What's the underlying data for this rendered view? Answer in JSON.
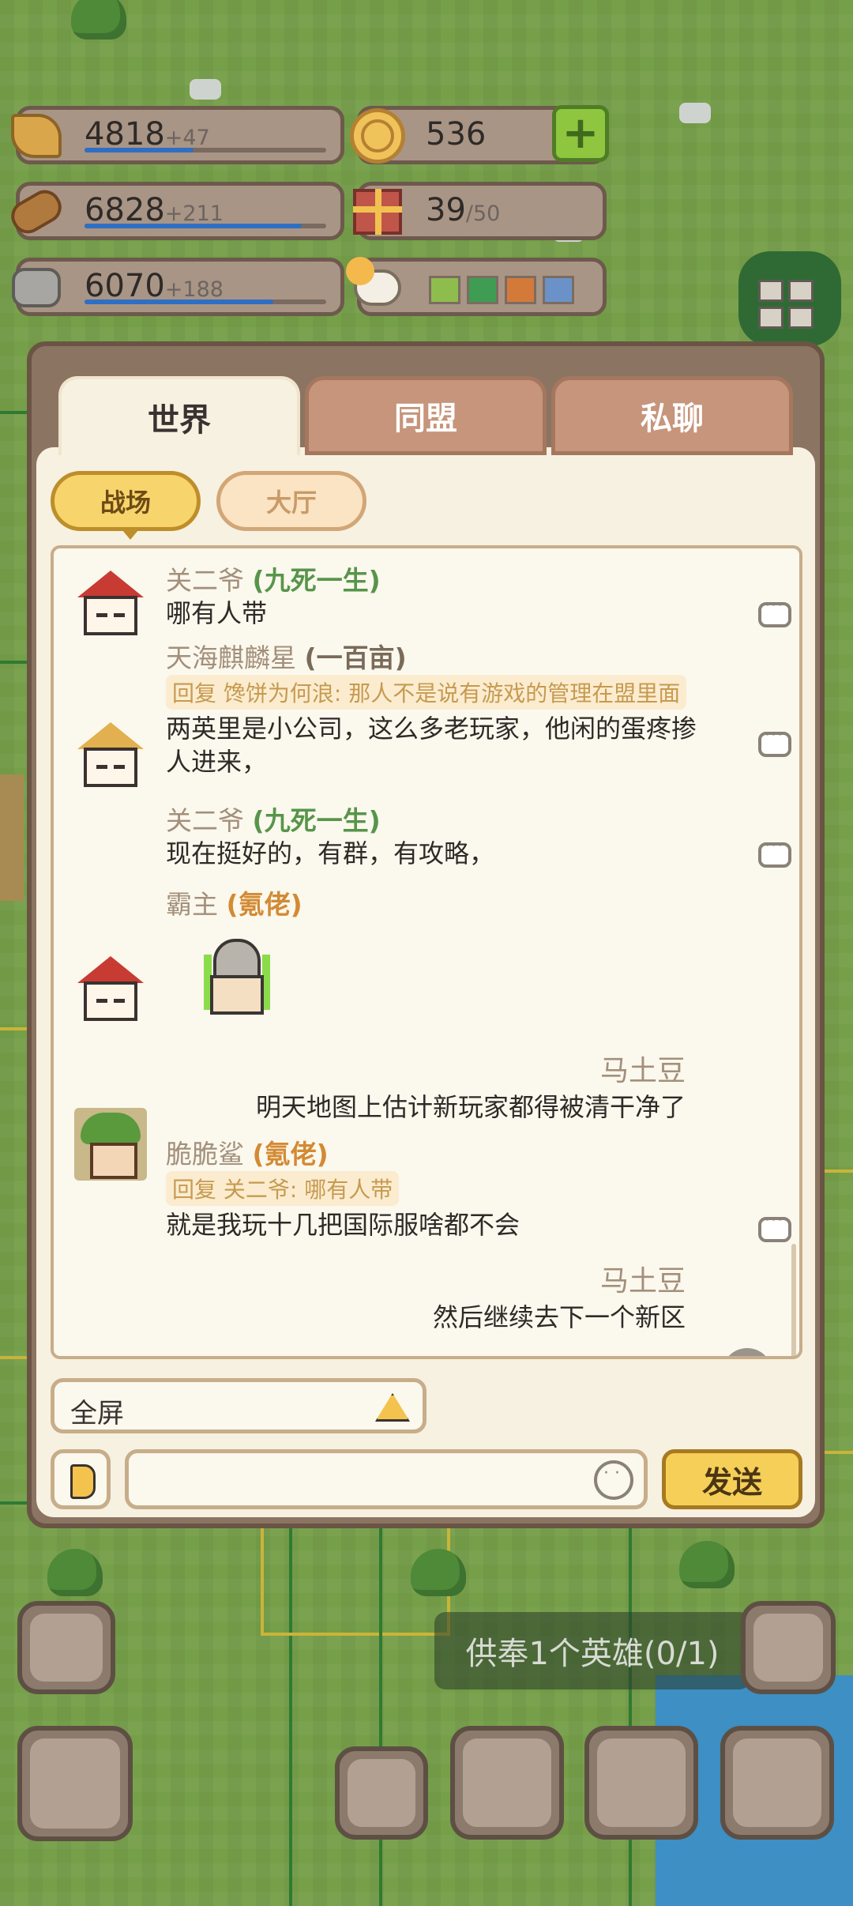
{
  "resources": {
    "food": {
      "value": "4818",
      "increment": "+47",
      "icon": "wheat-icon",
      "fill": 0.45
    },
    "wood": {
      "value": "6828",
      "increment": "+211",
      "icon": "wood-log-icon",
      "fill": 0.9
    },
    "stone": {
      "value": "6070",
      "increment": "+188",
      "icon": "stone-icon",
      "fill": 0.78
    },
    "gold": {
      "value": "536",
      "icon": "coin-icon"
    },
    "gift": {
      "value": "39",
      "max": "/50",
      "icon": "gift-box-icon"
    },
    "weather_colors": [
      "#8fbd4d",
      "#3f9c53",
      "#d37a3b",
      "#6a92c8"
    ]
  },
  "tabs": [
    {
      "label": "世界",
      "active": true
    },
    {
      "label": "同盟",
      "active": false
    },
    {
      "label": "私聊",
      "active": false
    }
  ],
  "subtabs": [
    {
      "label": "战场",
      "active": true
    },
    {
      "label": "大厅",
      "active": false
    }
  ],
  "messages": [
    {
      "name": "关二爷",
      "title": "(九死一生)",
      "text": "哪有人带"
    },
    {
      "name": "天海麒麟星",
      "title": "(一百亩)",
      "reply": "回复 馋饼为何浪: 那人不是说有游戏的管理在盟里面",
      "text": "两英里是小公司，这么多老玩家，他闲的蛋疼掺人进来，"
    },
    {
      "name": "关二爷",
      "title": "(九死一生)",
      "text": "现在挺好的，有群，有攻略，"
    },
    {
      "name": "霸主",
      "title": "(氪佬)",
      "text": ""
    },
    {
      "name": "马土豆",
      "text": "明天地图上估计新玩家都得被清干净了"
    },
    {
      "name": "脆脆鲨",
      "title": "(氪佬)",
      "reply": "回复 关二爷: 哪有人带",
      "text": "就是我玩十几把国际服啥都不会"
    },
    {
      "name": "马土豆",
      "text": "然后继续去下一个新区"
    }
  ],
  "input": {
    "fullscreen_label": "全屏",
    "message_placeholder": "",
    "send_label": "发送"
  },
  "toast": "供奉1个英雄(0/1)"
}
